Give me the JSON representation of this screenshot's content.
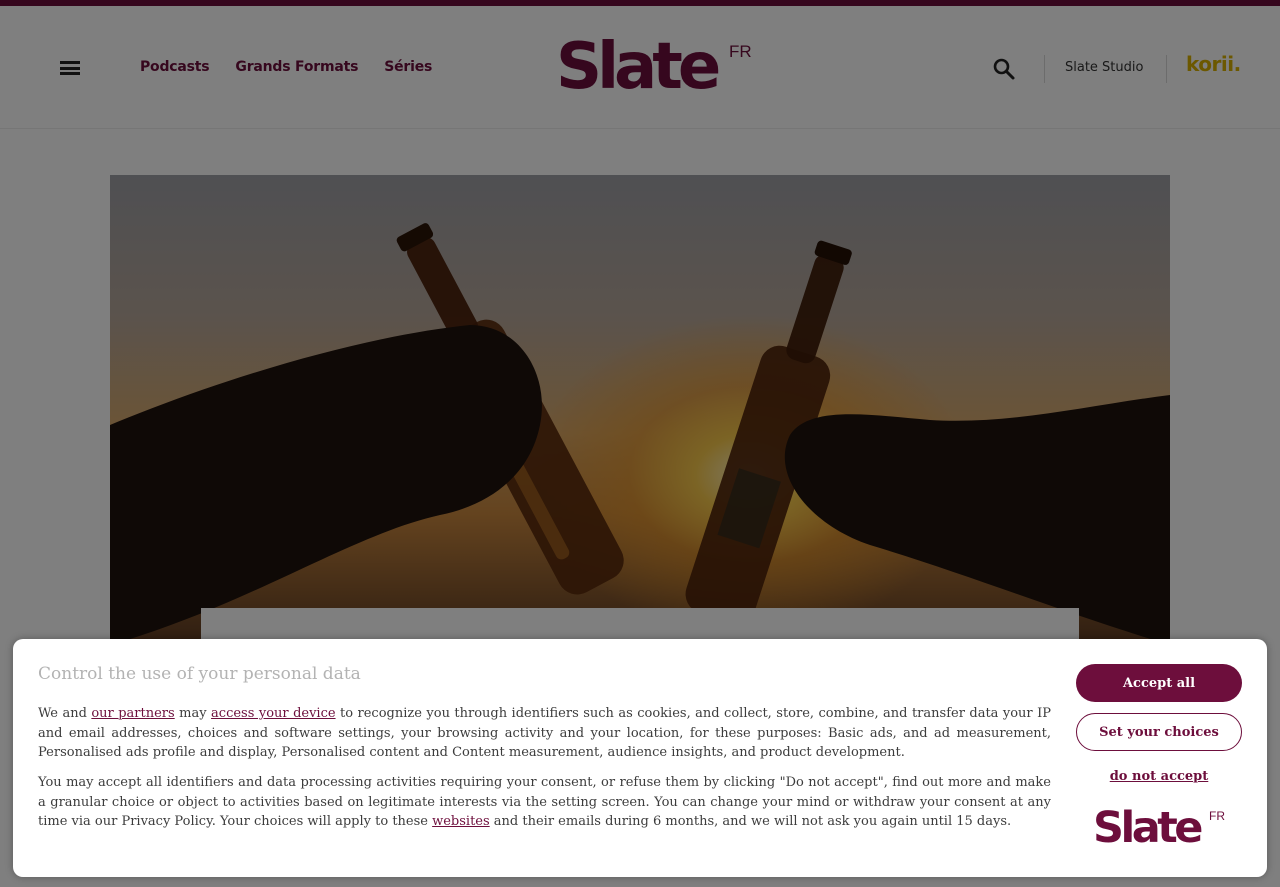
{
  "nav": {
    "items": [
      {
        "label": "Podcasts"
      },
      {
        "label": "Grands Formats"
      },
      {
        "label": "Séries"
      }
    ]
  },
  "logo": {
    "word": "Slate",
    "suffix": "FR"
  },
  "header_right": {
    "studio_label": "Slate Studio",
    "korii_label": "korii."
  },
  "icons": {
    "menu": "hamburger-menu-icon",
    "search": "search-icon"
  },
  "colors": {
    "brand": "#6d0e3c",
    "korii": "#d9b100"
  },
  "consent": {
    "title": "Control the use of your personal data",
    "p1_before_partners": "We and ",
    "partners_link": "our partners",
    "p1_may": " may ",
    "device_link": "access your device",
    "p1_after": " to recognize you through identifiers such as cookies, and collect, store, combine, and transfer data your IP and email addresses, choices and software settings, your browsing activity and your location, for these purposes: Basic ads, and ad measurement, Personalised ads profile and display, Personalised content and Content measurement, audience insights, and product development.",
    "p2_before": "You may accept all identifiers and data processing activities requiring your consent, or refuse them by clicking \"Do not accept\", find out more and make a granular choice or object to activities based on legitimate interests via the setting screen. You can change your mind or withdraw your consent at any time via our Privacy Policy. Your choices will apply to these ",
    "websites_link": "websites",
    "p2_after": " and their emails during 6 months, and we will not ask you again until 15 days.",
    "accept_label": "Accept all",
    "choices_label": "Set your choices",
    "refuse_label": "do not accept",
    "logo_word": "Slate",
    "logo_suffix": "FR"
  }
}
